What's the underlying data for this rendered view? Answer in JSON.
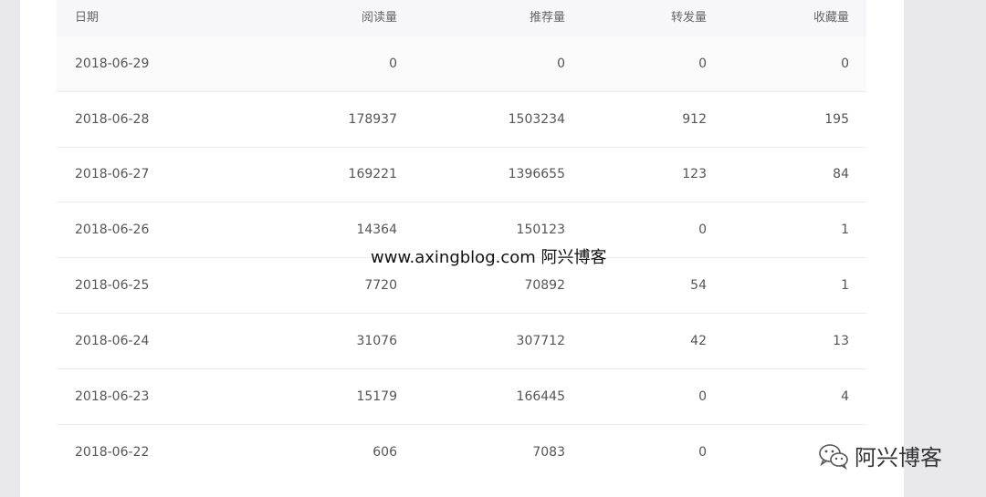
{
  "table": {
    "columns": [
      "日期",
      "阅读量",
      "推荐量",
      "转发量",
      "收藏量"
    ],
    "rows": [
      [
        "2018-06-29",
        "0",
        "0",
        "0",
        "0"
      ],
      [
        "2018-06-28",
        "178937",
        "1503234",
        "912",
        "195"
      ],
      [
        "2018-06-27",
        "169221",
        "1396655",
        "123",
        "84"
      ],
      [
        "2018-06-26",
        "14364",
        "150123",
        "0",
        "1"
      ],
      [
        "2018-06-25",
        "7720",
        "70892",
        "54",
        "1"
      ],
      [
        "2018-06-24",
        "31076",
        "307712",
        "42",
        "13"
      ],
      [
        "2018-06-23",
        "15179",
        "166445",
        "0",
        "4"
      ],
      [
        "2018-06-22",
        "606",
        "7083",
        "0",
        ""
      ]
    ]
  },
  "watermark": {
    "center": "www.axingblog.com 阿兴博客",
    "corner": "阿兴博客",
    "corner_icon": "wechat-icon"
  },
  "colors": {
    "background": "#e9e9ec",
    "panel": "#ffffff",
    "header_bg": "#f7f7f9",
    "text": "#555555"
  }
}
